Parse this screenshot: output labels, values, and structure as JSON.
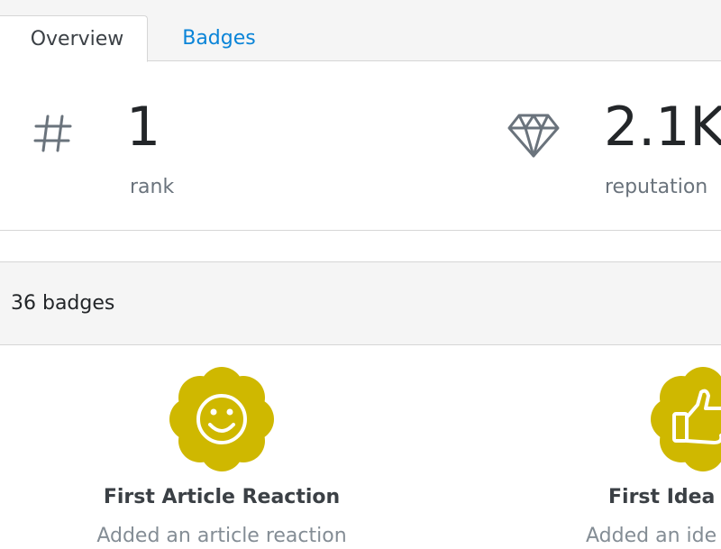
{
  "tabs": [
    {
      "label": "Overview",
      "active": true
    },
    {
      "label": "Badges",
      "active": false
    }
  ],
  "stats": {
    "rank": {
      "icon": "hash-icon",
      "value": "1",
      "label": "rank"
    },
    "reputation": {
      "icon": "diamond-icon",
      "value": "2.1K",
      "label": "reputation"
    }
  },
  "badges": {
    "count_label": "36 badges",
    "items": [
      {
        "title": "First Article Reaction",
        "description": "Added an article reaction",
        "icon": "smiley-icon",
        "color": "#cfb800"
      },
      {
        "title": "First Idea R",
        "description": "Added an ide",
        "icon": "thumbs-up-icon",
        "color": "#cfb800"
      }
    ]
  },
  "colors": {
    "accent": "#0a84d8",
    "badge_gold": "#cfb800",
    "muted": "#6a737c"
  }
}
